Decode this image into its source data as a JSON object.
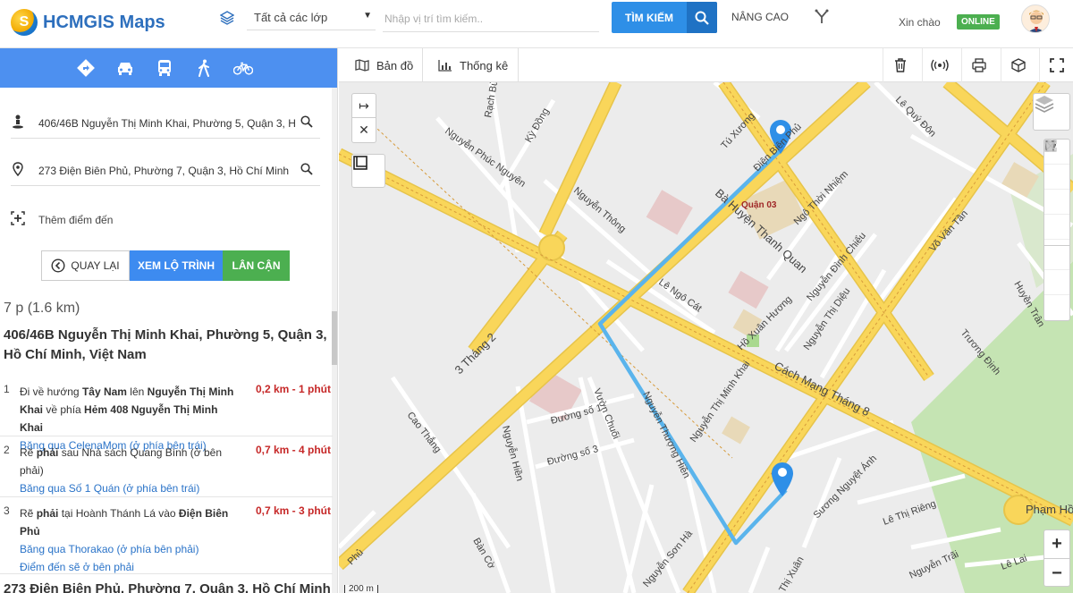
{
  "app": {
    "title": "HCMGIS Maps"
  },
  "header": {
    "layer_select": "Tất cả các lớp",
    "search_placeholder": "Nhập vị trí tìm kiếm..",
    "search_button": "TÌM KIẾM",
    "advanced": "NÂNG CAO",
    "greeting": "Xin chào",
    "status": "ONLINE"
  },
  "panel": {
    "modes": [
      "directions-icon",
      "car-icon",
      "bus-icon",
      "walk-icon",
      "bike-icon"
    ],
    "origin_input": "406/46B Nguyễn Thị Minh Khai, Phường 5, Quận 3, Hồ Chí Minh",
    "destination_input": "273 Điện Biên Phủ, Phường 7, Quận 3, Hồ Chí Minh",
    "add_destination": "Thêm điểm đến",
    "buttons": {
      "back": "QUAY LẠI",
      "route": "XEM LỘ TRÌNH",
      "nearby": "LÂN CẬN"
    },
    "summary": "7 p (1.6 km)",
    "origin_title": "406/46B Nguyễn Thị Minh Khai, Phường 5, Quận 3, Hồ Chí Minh, Việt Nam",
    "steps": [
      {
        "num": "1",
        "html": "Đi về hướng <b>Tây Nam</b> lên <b>Nguyễn Thị Minh Khai</b> về phía <b>Hẻm 408 Nguyễn Thị Minh Khai</b>",
        "dist": "0,2 km - 1 phút",
        "notes": [
          "Băng qua CelenaMom (ở phía bên trái)"
        ]
      },
      {
        "num": "2",
        "html": "Rẽ <b>phải</b> sau Nhà sách Quang Bình (ở bên phải)",
        "dist": "0,7 km - 4 phút",
        "notes": [
          "Băng qua Số 1 Quán (ở phía bên trái)"
        ]
      },
      {
        "num": "3",
        "html": "Rẽ <b>phải</b> tại Hoành Thánh Lá vào <b>Điện Biên Phủ</b>",
        "dist": "0,7 km - 3 phút",
        "notes": [
          "Băng qua Thorakao (ở phía bên phải)",
          "Điểm đến sẽ ở bên phải"
        ]
      }
    ],
    "destination_title": "273 Điện Biên Phủ, Phường 7, Quận 3, Hồ Chí Minh"
  },
  "map_toolbar": {
    "tab_map": "Bản đồ",
    "tab_stats": "Thống kê"
  },
  "map": {
    "scale": "200 m",
    "district_label": "Quận 03",
    "colors": {
      "route": "#5ab4ec",
      "major_road": "#f9d65a",
      "park": "#c5e4b3",
      "marker": "#2e8fe7"
    },
    "street_labels": [
      "Điện Biên Phủ",
      "Bà Huyện Thanh Quan",
      "Cách Mạng Tháng 8",
      "3 Tháng 2",
      "Nguyễn Thị Minh Khai",
      "Nguyễn Phúc Nguyên",
      "Kỳ Đồng",
      "Rạch Bùng",
      "Tú Xương",
      "Lê Quý Đôn",
      "Ngô Thời Nhiệm",
      "Nguyễn Thông",
      "Lê Ngô Cát",
      "Hồ Xuân Hương",
      "Nguyễn Thị Diệu",
      "Nguyễn Đình Chiểu",
      "Võ Văn Tần",
      "Huyền Trân",
      "Trương Định",
      "Đường số 1",
      "Đường số 3",
      "Vườn Chuối",
      "Nguyễn Thượng Hiền",
      "Cao Thắng",
      "Nguyễn Hiền",
      "Bàn Cờ",
      "Nguyễn Sơn Hà",
      "Sương Nguyệt Ánh",
      "Lê Thị Riêng",
      "Phạm Hồ",
      "Nguyễn Trãi",
      "Lê Lai",
      "Thị Xuân",
      "Phủ"
    ]
  }
}
